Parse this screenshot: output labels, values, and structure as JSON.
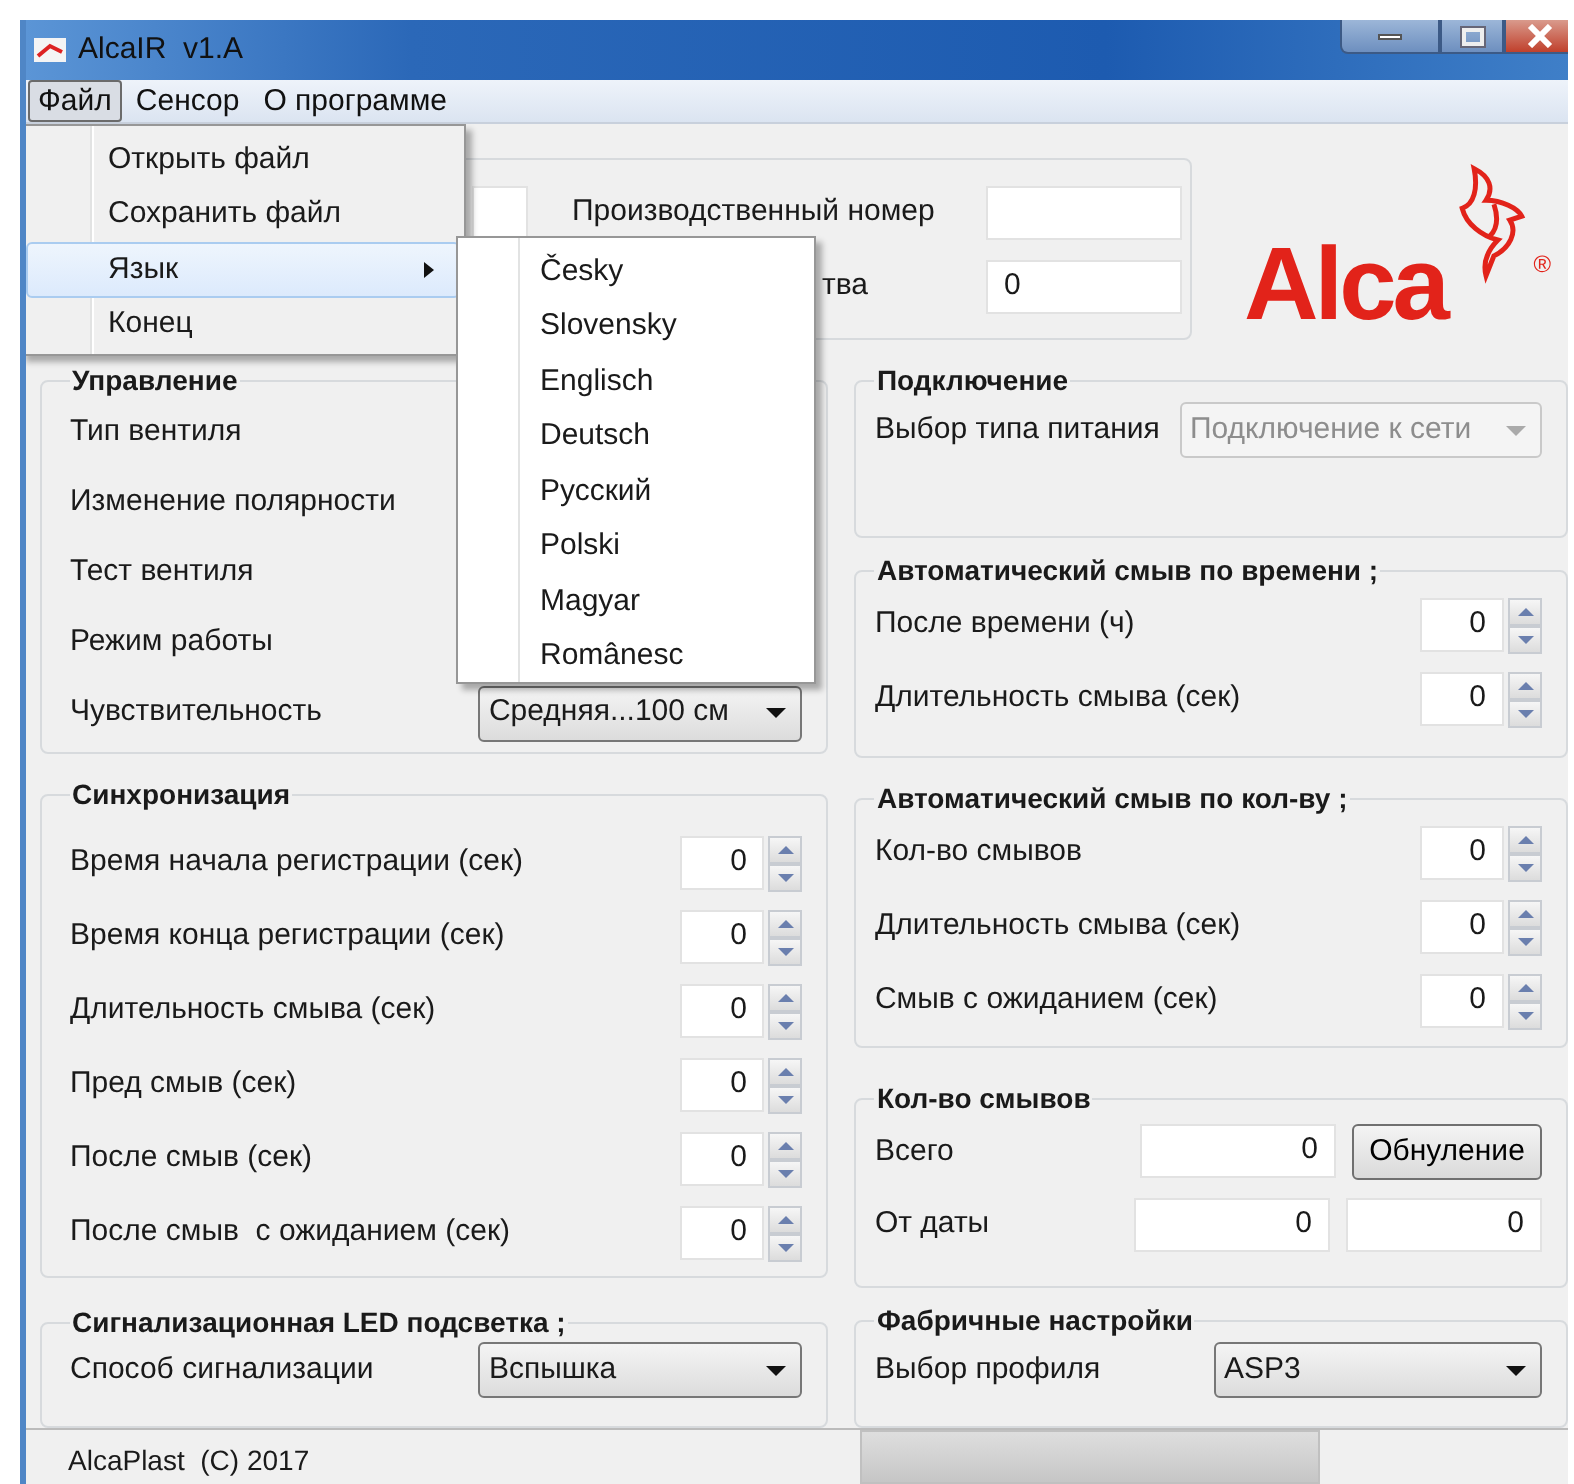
{
  "window": {
    "title": "AlcaIR  v1.A"
  },
  "menu_bar": [
    {
      "label": "Файл",
      "selected": true
    },
    {
      "label": "Сенсор",
      "selected": false
    },
    {
      "label": "О программе",
      "selected": false
    }
  ],
  "file_menu": [
    {
      "label": "Открыть файл",
      "selected": false,
      "submenu": false
    },
    {
      "label": "Сохранить файл",
      "selected": false,
      "submenu": false
    },
    {
      "label": "Язык",
      "selected": true,
      "submenu": true
    },
    {
      "label": "Конец",
      "selected": false,
      "submenu": false
    }
  ],
  "language_menu": [
    "Česky",
    "Slovensky",
    "Englisch",
    "Deutsch",
    "Русский",
    "Polski",
    "Magyar",
    "Românesc"
  ],
  "device": {
    "serial_label": "Производственный номер",
    "label_2": "тва",
    "value_2": "0"
  },
  "logo": {
    "text": "Alca",
    "mark": "®"
  },
  "left_groups": [
    {
      "title": "Управление",
      "rows": [
        {
          "kind": "label",
          "label": "Тип вентиля"
        },
        {
          "kind": "label",
          "label": "Изменение полярности"
        },
        {
          "kind": "label",
          "label": "Тест вентиля"
        },
        {
          "kind": "label",
          "label": "Режим работы"
        },
        {
          "kind": "dropdown",
          "label": "Чувствительность",
          "value": "Средняя...100 см",
          "disabled": false
        }
      ]
    },
    {
      "title": "Синхронизация",
      "rows": [
        {
          "kind": "spinner",
          "label": "Время начала регистрации (сек)",
          "value": "0"
        },
        {
          "kind": "spinner",
          "label": "Время конца регистрации (сек)",
          "value": "0"
        },
        {
          "kind": "spinner",
          "label": "Длительность смыва (сек)",
          "value": "0"
        },
        {
          "kind": "spinner",
          "label": "Пред смыв (сек)",
          "value": "0"
        },
        {
          "kind": "spinner",
          "label": "После смыв (сек)",
          "value": "0"
        },
        {
          "kind": "spinner",
          "label": "После смыв  с ожиданием (сек)",
          "value": "0"
        }
      ]
    },
    {
      "title": "Сигнализационная LED подсветка ;",
      "rows": [
        {
          "kind": "dropdown",
          "label": "Способ сигнализации",
          "value": "Вспышка",
          "disabled": false
        }
      ]
    }
  ],
  "right_groups": [
    {
      "title": "Подключение",
      "rows": [
        {
          "kind": "dropdown",
          "label": "Выбор типа питания",
          "value": "Подключение к сети",
          "disabled": true
        }
      ]
    },
    {
      "title": "Автоматический смыв по времени ;",
      "rows": [
        {
          "kind": "spinner",
          "label": "После времени (ч)",
          "value": "0"
        },
        {
          "kind": "spinner",
          "label": "Длительность смыва (сек)",
          "value": "0"
        }
      ]
    },
    {
      "title": "Автоматический смыв по кол-ву ;",
      "rows": [
        {
          "kind": "spinner",
          "label": "Кол-во смывов",
          "value": "0"
        },
        {
          "kind": "spinner",
          "label": "Длительность смыва (сек)",
          "value": "0"
        },
        {
          "kind": "spinner",
          "label": "Смыв с ожиданием (сек)",
          "value": "0"
        }
      ]
    },
    {
      "title": "Кол-во смывов",
      "rows": [
        {
          "kind": "counter",
          "label": "Всего",
          "fields": [
            "0"
          ],
          "button": "Обнуление"
        },
        {
          "kind": "counter",
          "label": "От даты",
          "fields": [
            "0",
            "0"
          ]
        }
      ]
    },
    {
      "title": "Фабричные настройки",
      "rows": [
        {
          "kind": "dropdown",
          "label": "Выбор профиля",
          "value": "ASP3",
          "disabled": false
        }
      ]
    }
  ],
  "status_bar": {
    "text": "AlcaPlast  (C) 2017"
  }
}
